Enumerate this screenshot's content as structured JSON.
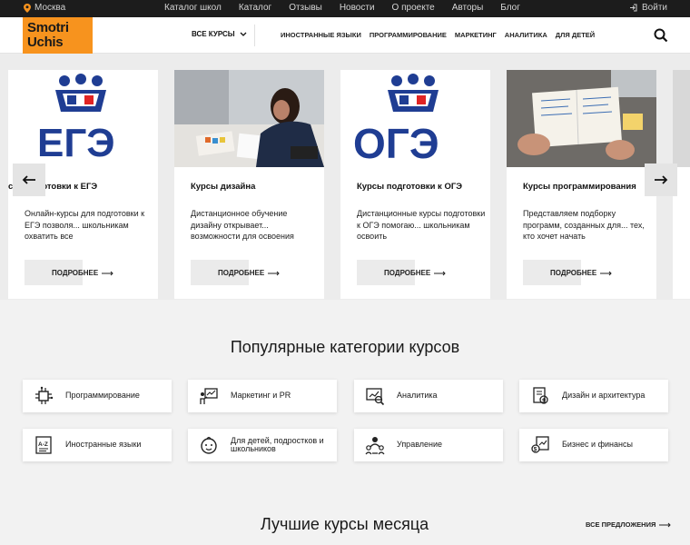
{
  "topbar": {
    "city": "Москва",
    "nav": [
      "Каталог школ",
      "Каталог",
      "Отзывы",
      "Новости",
      "О проекте",
      "Авторы",
      "Блог"
    ],
    "login": "Войти"
  },
  "header": {
    "logo_line1": "Smotri",
    "logo_line2": "Uchis",
    "all_courses": "ВСЕ КУРСЫ",
    "categories": [
      "ИНОСТРАННЫЕ ЯЗЫКИ",
      "ПРОГРАММИРОВАНИЕ",
      "МАРКЕТИНГ",
      "АНАЛИТИКА",
      "ДЛЯ ДЕТЕЙ"
    ]
  },
  "carousel": {
    "cards": [
      {
        "title": "сы подготовки к ЕГЭ",
        "desc": "Онлайн-курсы для подготовки к ЕГЭ позволя... школьникам охватить все",
        "more": "ПОДРОБНЕЕ",
        "image_text": "ЕГЭ"
      },
      {
        "title": "Курсы дизайна",
        "desc": "Дистанционное обучение дизайну открывает... возможности для освоения",
        "more": "ПОДРОБНЕЕ",
        "image_text": ""
      },
      {
        "title": "Курсы подготовки к ОГЭ",
        "desc": "Дистанционные курсы подготовки к ОГЭ помогаю... школьникам освоить",
        "more": "ПОДРОБНЕЕ",
        "image_text": "ОГЭ"
      },
      {
        "title": "Курсы программирования",
        "desc": "Представляем подборку программ, созданных для... тех, кто хочет начать",
        "more": "ПОДРОБНЕЕ",
        "image_text": ""
      }
    ]
  },
  "categories": {
    "title": "Популярные категории курсов",
    "items": [
      {
        "label": "Программирование",
        "icon": "circuit-icon"
      },
      {
        "label": "Маркетинг и PR",
        "icon": "presentation-icon"
      },
      {
        "label": "Аналитика",
        "icon": "analytics-icon"
      },
      {
        "label": "Дизайн и архитектура",
        "icon": "design-icon"
      },
      {
        "label": "Иностранные языки",
        "icon": "language-icon"
      },
      {
        "label": "Для детей, подростков и школьников",
        "icon": "child-icon"
      },
      {
        "label": "Управление",
        "icon": "management-icon"
      },
      {
        "label": "Бизнес и финансы",
        "icon": "finance-icon"
      }
    ]
  },
  "best": {
    "title": "Лучшие курсы месяца",
    "all_offers": "ВСЕ ПРЕДЛОЖЕНИЯ"
  },
  "colors": {
    "accent": "#f7931e",
    "topbar": "#1c1c1c",
    "ege_blue": "#1f3d93",
    "ege_red": "#e02424"
  }
}
